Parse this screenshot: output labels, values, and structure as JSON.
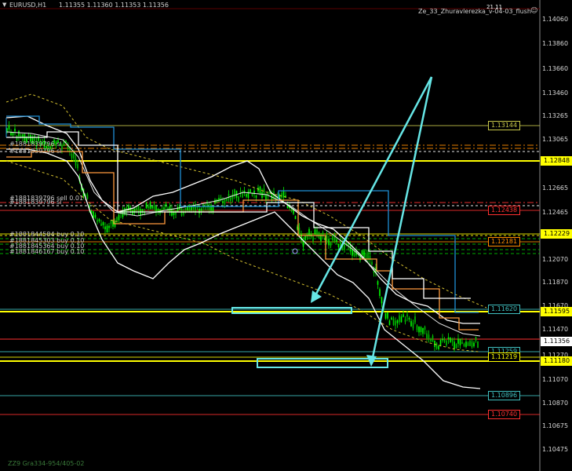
{
  "header": {
    "menu_icon": "triangle-down-icon",
    "symbol": "EURUSD,H1",
    "ohlc": "1.11355 1.11360 1.11353 1.11356",
    "indicator": "Ze_33_Zhuravlerezka_v-04-03_flush",
    "indicator_icon": "smiley-icon",
    "indicator_extra": "21.11"
  },
  "orders": {
    "sell": "#1881839796 sell 0.01",
    "sell_shadow": "#1881839796 sl",
    "buy1": "#1881844584 buy 0.10",
    "buy2": "#1881845303 buy 0.10",
    "buy3": "#1881845364 buy 0.10",
    "buy4": "#1881846167 buy 0.10"
  },
  "price_axis": {
    "ticks": [
      "1.14060",
      "1.13860",
      "1.13660",
      "1.13460",
      "1.13265",
      "1.13065",
      "1.12865",
      "1.12665",
      "1.12465",
      "1.12265",
      "1.12070",
      "1.11870",
      "1.11670",
      "1.11470",
      "1.11270",
      "1.11070",
      "1.10870",
      "1.10675",
      "1.10475"
    ],
    "current_price": "1.11356"
  },
  "levels": [
    {
      "label": "1.13144",
      "color": "#c8c84a"
    },
    {
      "label": "1.12848",
      "color": "#ffff00"
    },
    {
      "label": "1.12438",
      "color": "#ff3030"
    },
    {
      "label": "1.12229",
      "color": "#ffff00"
    },
    {
      "label": "1.12181",
      "color": "#ff8c00"
    },
    {
      "label": "1.11620",
      "color": "#40c0c0"
    },
    {
      "label": "1.11595",
      "color": "#ffff00"
    },
    {
      "label": "1.11259",
      "color": "#40c0c0"
    },
    {
      "label": "1.11219",
      "color": "#ffff00"
    },
    {
      "label": "1.11180",
      "color": "#ffff00"
    },
    {
      "label": "1.10896",
      "color": "#40c0c0"
    },
    {
      "label": "1.10740",
      "color": "#ff3030"
    }
  ],
  "status_text": "ZZ9 Gra334-954/405-02",
  "colors": {
    "candle_up": "#00c000",
    "candle_down": "#00c000",
    "envelope": "#ffffff",
    "arrow": "#66e6e6",
    "level_yellow": "#ffff00",
    "level_red": "#ff3030",
    "level_cyan": "#40c0c0",
    "orange": "#ff8c00",
    "blue_step": "#1f8fd6"
  }
}
